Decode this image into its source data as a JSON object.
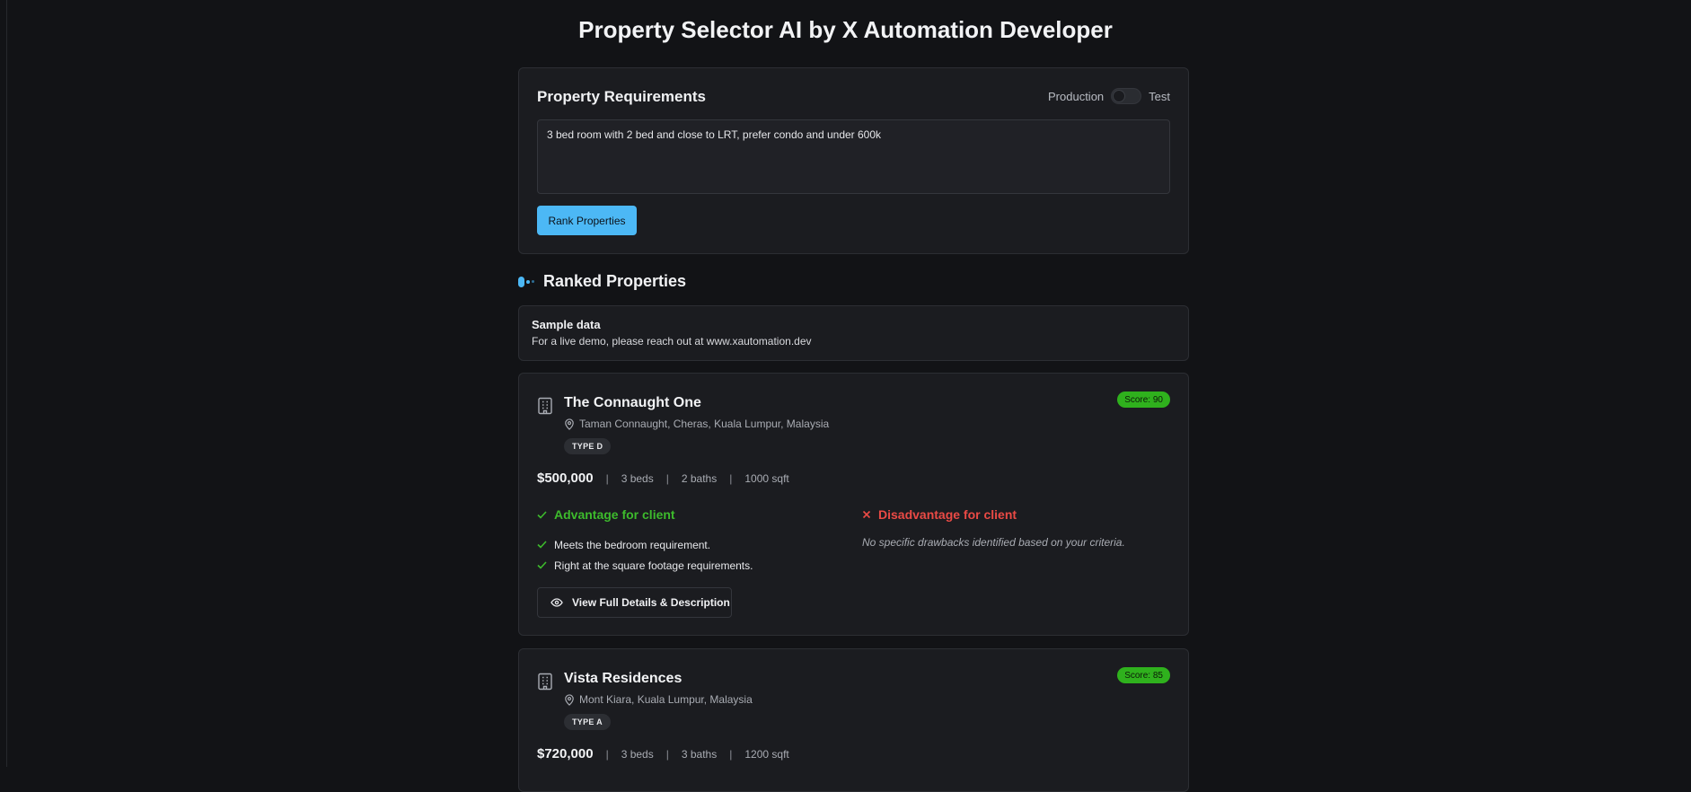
{
  "page_title": "Property Selector AI by X Automation Developer",
  "requirements": {
    "title": "Property Requirements",
    "toggle_left": "Production",
    "toggle_right": "Test",
    "query": "3 bed room with 2 bed and close to LRT, prefer condo and under 600k",
    "rank_button": "Rank Properties"
  },
  "ranked": {
    "title": "Ranked Properties",
    "sample_title": "Sample data",
    "sample_text": "For a live demo, please reach out at www.xautomation.dev"
  },
  "properties": [
    {
      "name": "The Connaught One",
      "location": "Taman Connaught, Cheras, Kuala Lumpur, Malaysia",
      "type": "TYPE D",
      "score": "Score: 90",
      "price": "$500,000",
      "beds": "3 beds",
      "baths": "2 baths",
      "sqft": "1000 sqft",
      "advantage_title": "Advantage for client",
      "advantages": [
        "Meets the bedroom requirement.",
        "Right at the square footage requirements."
      ],
      "disadvantage_title": "Disadvantage for client",
      "disadvantage_text": "No specific drawbacks identified based on your criteria.",
      "details_button": "View Full Details & Description"
    },
    {
      "name": "Vista Residences",
      "location": "Mont Kiara, Kuala Lumpur, Malaysia",
      "type": "TYPE A",
      "score": "Score: 85",
      "price": "$720,000",
      "beds": "3 beds",
      "baths": "3 baths",
      "sqft": "1200 sqft"
    }
  ],
  "icons": {
    "building": "building-icon",
    "location": "map-pin-icon",
    "check": "check-icon",
    "cross": "x-icon",
    "eye": "eye-icon"
  },
  "colors": {
    "background": "#121316",
    "panel": "#1b1c20",
    "accent": "#4cb8f5",
    "score_badge": "#2fb11d",
    "advantage": "#3dbb2c",
    "disadvantage": "#ea4a45"
  }
}
